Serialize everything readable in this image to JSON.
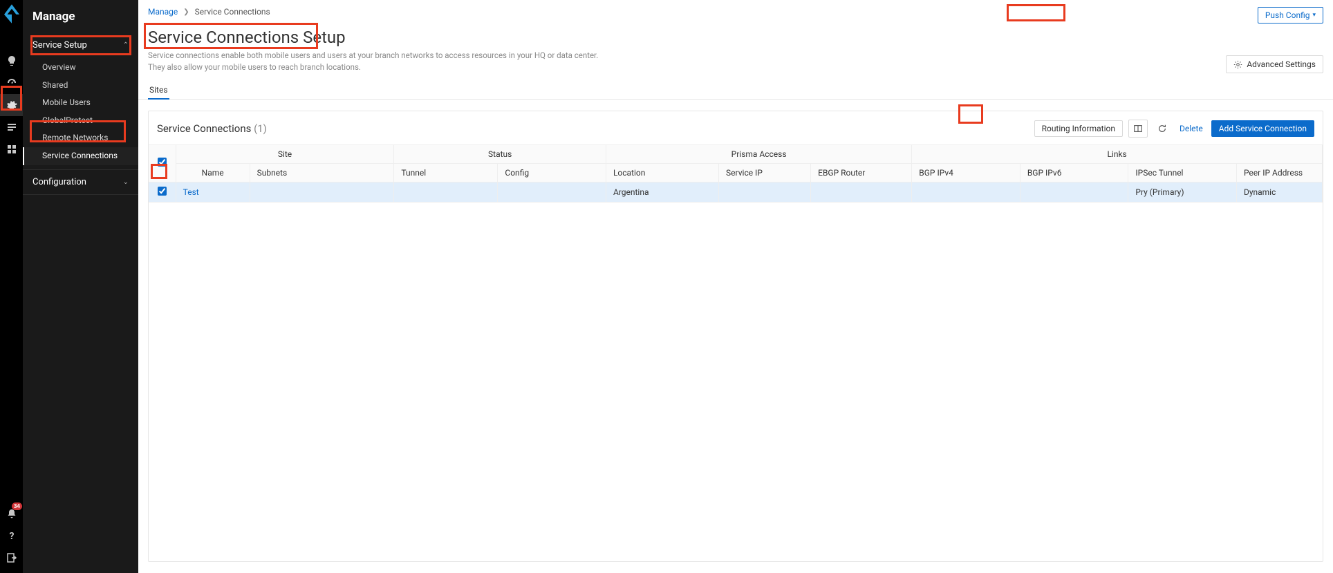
{
  "rail": {
    "notification_count": "34"
  },
  "sidebar": {
    "title": "Manage",
    "groups": [
      {
        "label": "Service Setup",
        "expanded": true,
        "items": [
          "Overview",
          "Shared",
          "Mobile Users",
          "GlobalProtect",
          "Remote Networks",
          "Service Connections"
        ],
        "active_index": 5
      },
      {
        "label": "Configuration",
        "expanded": false,
        "items": []
      }
    ]
  },
  "breadcrumb": {
    "root": "Manage",
    "current": "Service Connections"
  },
  "push_config_label": "Push Config",
  "page": {
    "title": "Service Connections Setup",
    "desc1": "Service connections enable both mobile users and users at your branch networks to access resources in your HQ or data center.",
    "desc2": "They also allow your mobile users to reach branch locations."
  },
  "advanced_settings_label": "Advanced Settings",
  "tabs": [
    "Sites"
  ],
  "panel": {
    "title": "Service Connections",
    "count": "(1)",
    "actions": {
      "routing": "Routing Information",
      "delete": "Delete",
      "add": "Add Service Connection"
    },
    "group_headers": {
      "site": "Site",
      "status": "Status",
      "prisma": "Prisma Access",
      "links": "Links"
    },
    "columns": [
      "Name",
      "Subnets",
      "Tunnel",
      "Config",
      "Location",
      "Service IP",
      "EBGP Router",
      "BGP IPv4",
      "BGP IPv6",
      "IPSec Tunnel",
      "Peer IP Address"
    ],
    "rows": [
      {
        "selected": true,
        "name": "Test",
        "subnets": "",
        "tunnel": "",
        "config": "",
        "location": "Argentina",
        "service_ip": "",
        "ebgp": "",
        "bgp4": "",
        "bgp6": "",
        "ipsec": "Pry (Primary)",
        "peer": "Dynamic"
      }
    ]
  }
}
